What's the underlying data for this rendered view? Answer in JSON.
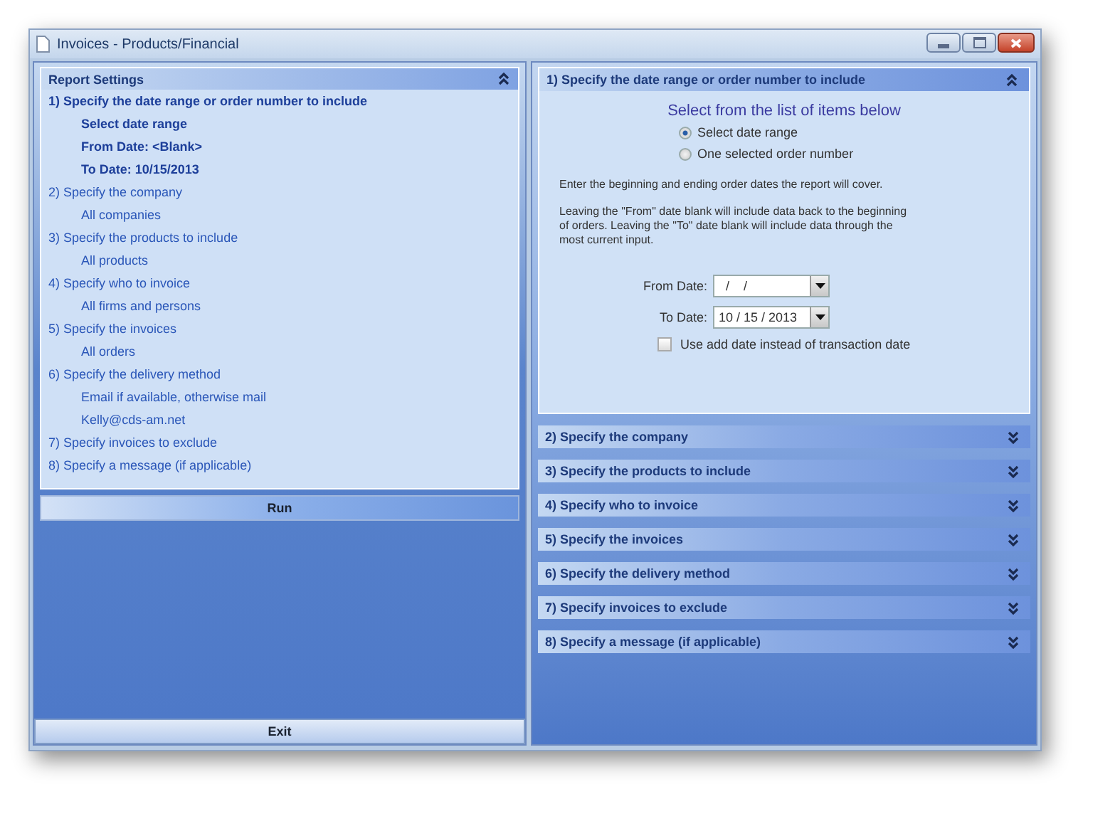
{
  "window": {
    "title": "Invoices - Products/Financial"
  },
  "report_settings": {
    "title": "Report Settings",
    "expanded": true,
    "steps": [
      {
        "label": "1)  Specify the date range or order number to include",
        "current": true,
        "details": [
          "Select date range",
          "From Date:  <Blank>",
          "To Date:  10/15/2013"
        ]
      },
      {
        "label": "2)  Specify the company",
        "current": false,
        "details": [
          "All companies"
        ]
      },
      {
        "label": "3)  Specify the products to include",
        "current": false,
        "details": [
          "All products"
        ]
      },
      {
        "label": "4)  Specify who to invoice",
        "current": false,
        "details": [
          "All firms and persons"
        ]
      },
      {
        "label": "5)  Specify the invoices",
        "current": false,
        "details": [
          "All orders"
        ]
      },
      {
        "label": "6)  Specify the delivery method",
        "current": false,
        "details": [
          "Email if available, otherwise mail",
          "Kelly@cds-am.net"
        ]
      },
      {
        "label": "7)  Specify invoices to exclude",
        "current": false
      },
      {
        "label": "8)  Specify a message (if applicable)",
        "current": false
      }
    ]
  },
  "run_button": "Run",
  "exit_button": "Exit",
  "sections": [
    {
      "title": "1)  Specify the date range or order number to include",
      "expanded": true,
      "prompt": "Select from the list of items below",
      "options": [
        {
          "label": "Select date range",
          "selected": true
        },
        {
          "label": "One selected order number",
          "selected": false
        }
      ],
      "notes": [
        "Enter the beginning and ending order dates the report will cover.",
        "Leaving the \"From\" date blank will include data back to the beginning of orders.  Leaving the \"To\" date blank will include data through the most current input."
      ],
      "dates": [
        {
          "label": "From Date:",
          "value": "  /    /"
        },
        {
          "label": "To Date:",
          "value": "10 / 15 / 2013"
        }
      ],
      "use_add_date": {
        "label": "Use add date instead of transaction date",
        "checked": false
      }
    },
    {
      "title": "2)  Specify the company",
      "expanded": false
    },
    {
      "title": "3)  Specify the products to include",
      "expanded": false
    },
    {
      "title": "4)  Specify who to invoice",
      "expanded": false
    },
    {
      "title": "5)  Specify the invoices",
      "expanded": false
    },
    {
      "title": "6)  Specify the delivery method",
      "expanded": false
    },
    {
      "title": "7)  Specify invoices to exclude",
      "expanded": false
    },
    {
      "title": "8)  Specify a message (if applicable)",
      "expanded": false
    }
  ]
}
